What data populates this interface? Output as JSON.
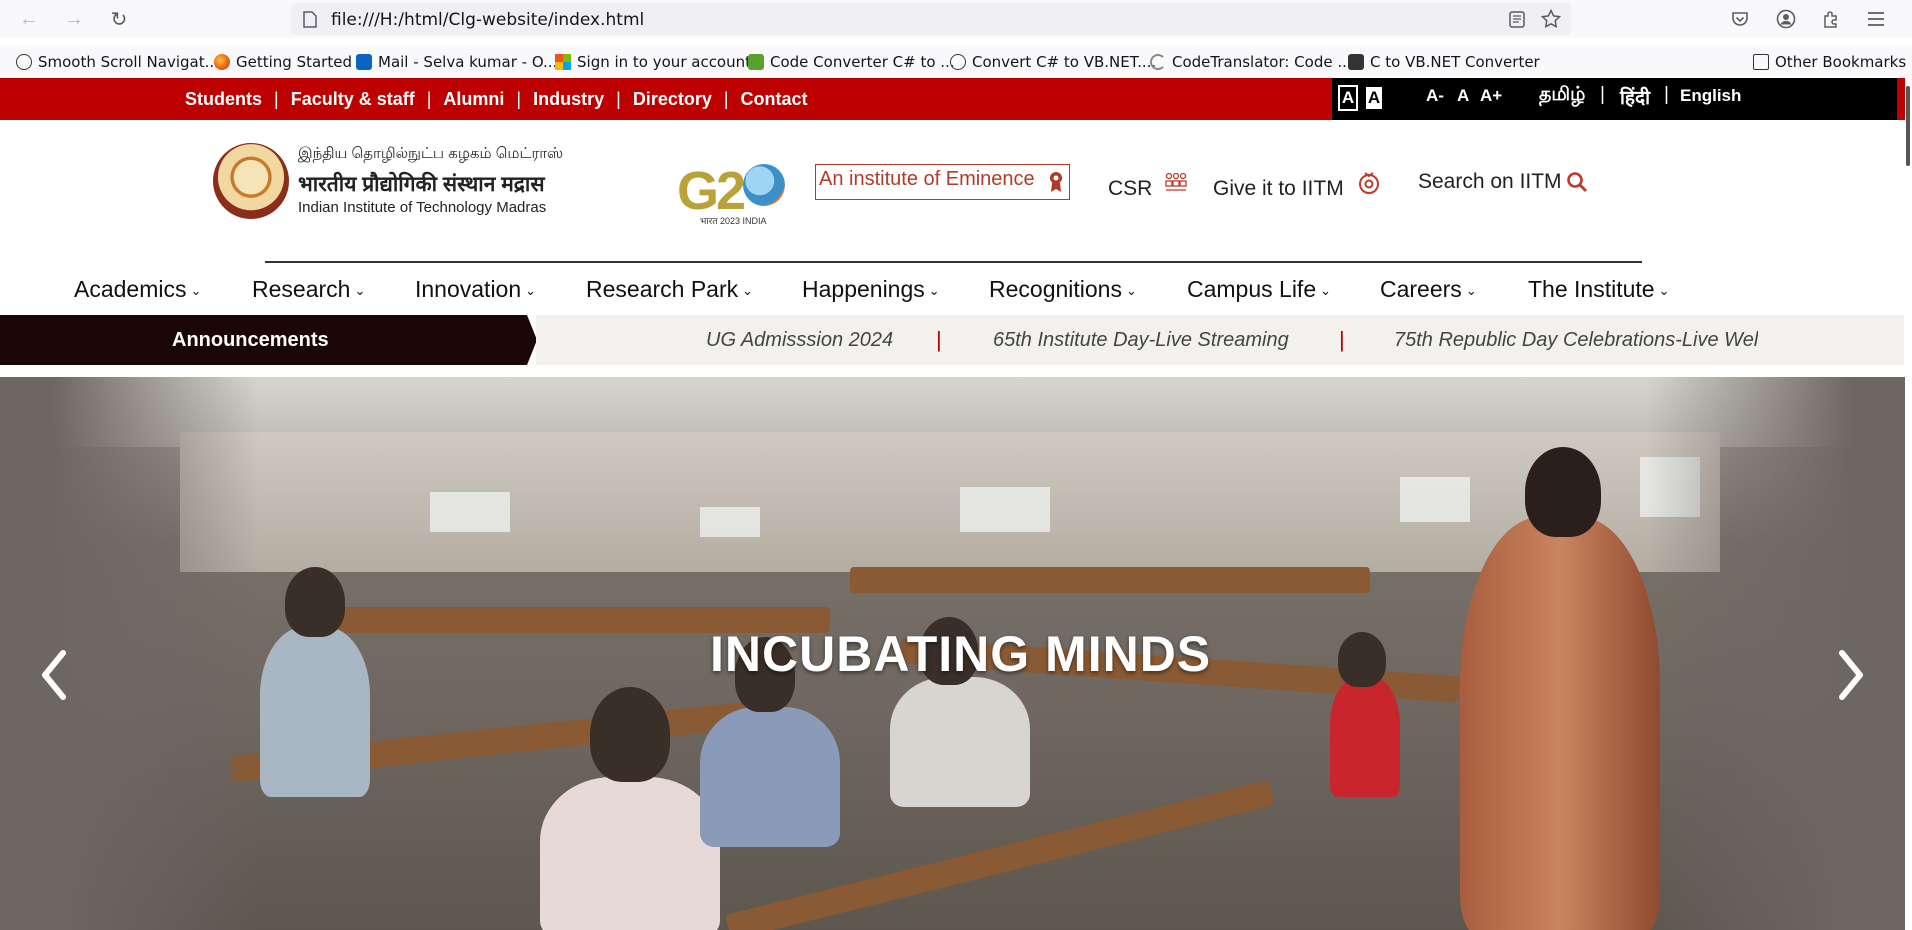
{
  "browser": {
    "url": "file:///H:/html/Clg-website/index.html",
    "bookmarks": [
      {
        "label": "Smooth Scroll Navigat...",
        "icon": "globe-icon"
      },
      {
        "label": "Getting Started",
        "icon": "firefox-icon"
      },
      {
        "label": "Mail - Selva kumar - O...",
        "icon": "outlook-icon"
      },
      {
        "label": "Sign in to your account",
        "icon": "microsoft-icon"
      },
      {
        "label": "Code Converter C# to ...",
        "icon": "code-converter-icon"
      },
      {
        "label": "Convert C# to VB.NET....",
        "icon": "globe-icon"
      },
      {
        "label": "CodeTranslator: Code ...",
        "icon": "codetranslator-icon"
      },
      {
        "label": "C to VB.NET Converter",
        "icon": "code-icon"
      }
    ],
    "other_bookmarks": "Other Bookmarks"
  },
  "top_bar": {
    "links": [
      "Students",
      "Faculty & staff",
      "Alumni",
      "Industry",
      "Directory",
      "Contact"
    ],
    "separator": "|",
    "contrast": [
      "A",
      "A"
    ],
    "font_sizes": [
      "A-",
      "A",
      "A+"
    ],
    "languages": [
      "தமிழ்",
      "हिंदी",
      "English"
    ],
    "colors": {
      "bar": "#bd0000",
      "panel": "#000000"
    }
  },
  "header": {
    "logo_tamil": "இந்திய தொழில்நுட்ப கழகம் மெட்ராஸ்",
    "logo_hindi": "भारतीय प्रौद्योगिकी संस्थान मद्रास",
    "logo_english": "Indian Institute of Technology Madras",
    "g20_text": "G2",
    "g20_sub": "भारत 2023 INDIA",
    "eminence": "An institute of Eminence",
    "csr": "CSR",
    "give": "Give it to IITM",
    "search": "Search on IITM"
  },
  "nav": {
    "items": [
      "Academics",
      "Research",
      "Innovation",
      "Research Park",
      "Happenings",
      "Recognitions",
      "Campus Life",
      "Careers",
      "The Institute"
    ]
  },
  "announcements": {
    "label": "Announcements",
    "items": [
      "UG Admisssion 2024",
      "65th Institute Day-Live Streaming",
      "75th Republic Day Celebrations-Live Wel"
    ],
    "separator": "|"
  },
  "hero": {
    "title": "INCUBATING MINDS"
  }
}
